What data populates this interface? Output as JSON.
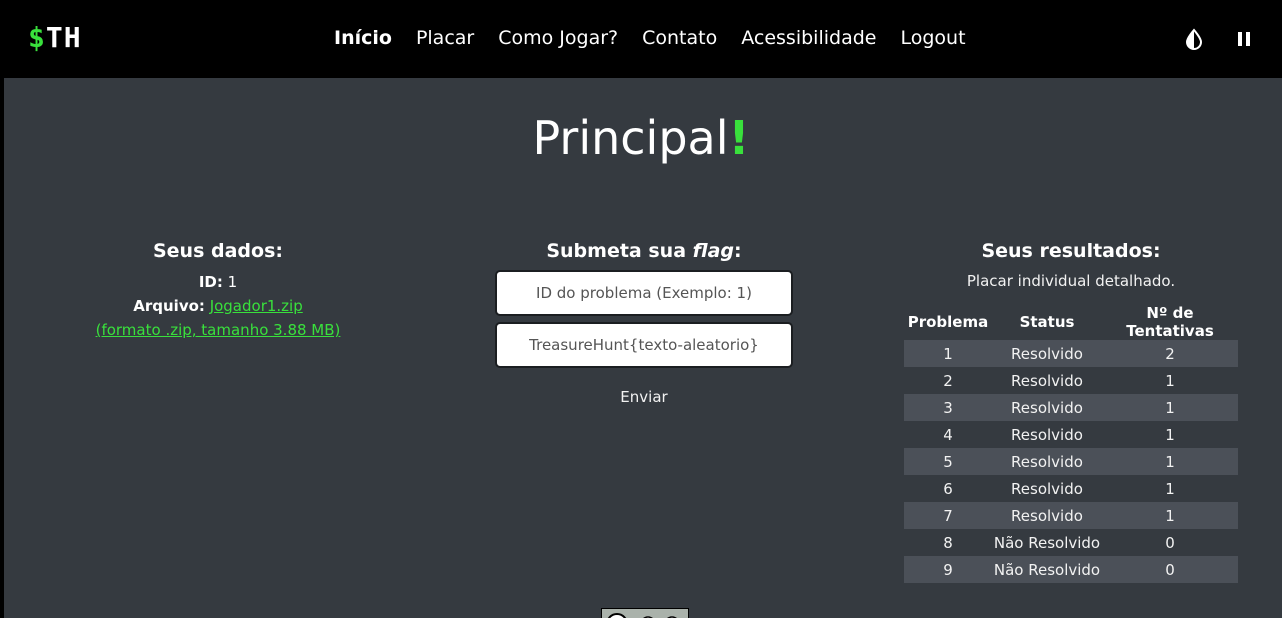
{
  "nav": {
    "logo_dollar": "$",
    "logo_text": "TH",
    "links": [
      "Início",
      "Placar",
      "Como Jogar?",
      "Contato",
      "Acessibilidade",
      "Logout"
    ],
    "icons": [
      "contrast-icon",
      "pause-icon"
    ]
  },
  "page": {
    "title": "Principal",
    "title_accent": "!"
  },
  "dados": {
    "title": "Seus dados:",
    "id_label": "ID:",
    "id_value": "1",
    "arquivo_label": "Arquivo:",
    "arquivo_link": "Jogador1.zip",
    "formato": "(formato .zip, tamanho 3.88 MB)"
  },
  "submit": {
    "title_prefix": "Submeta sua ",
    "title_em": "flag",
    "title_suffix": ":",
    "id_placeholder": "ID do problema (Exemplo: 1)",
    "flag_placeholder": "TreasureHunt{texto-aleatorio}",
    "button": "Enviar"
  },
  "resultados": {
    "title": "Seus resultados:",
    "subtitle": "Placar individual detalhado.",
    "headers": [
      "Problema",
      "Status",
      "Nº de Tentativas"
    ],
    "rows": [
      [
        "1",
        "Resolvido",
        "2"
      ],
      [
        "2",
        "Resolvido",
        "1"
      ],
      [
        "3",
        "Resolvido",
        "1"
      ],
      [
        "4",
        "Resolvido",
        "1"
      ],
      [
        "5",
        "Resolvido",
        "1"
      ],
      [
        "6",
        "Resolvido",
        "1"
      ],
      [
        "7",
        "Resolvido",
        "1"
      ],
      [
        "8",
        "Não Resolvido",
        "0"
      ],
      [
        "9",
        "Não Resolvido",
        "0"
      ]
    ]
  },
  "colors": {
    "accent": "#39e03c",
    "background": "#353a40",
    "navbar": "#000000",
    "row_stripe": "#4b5058"
  }
}
